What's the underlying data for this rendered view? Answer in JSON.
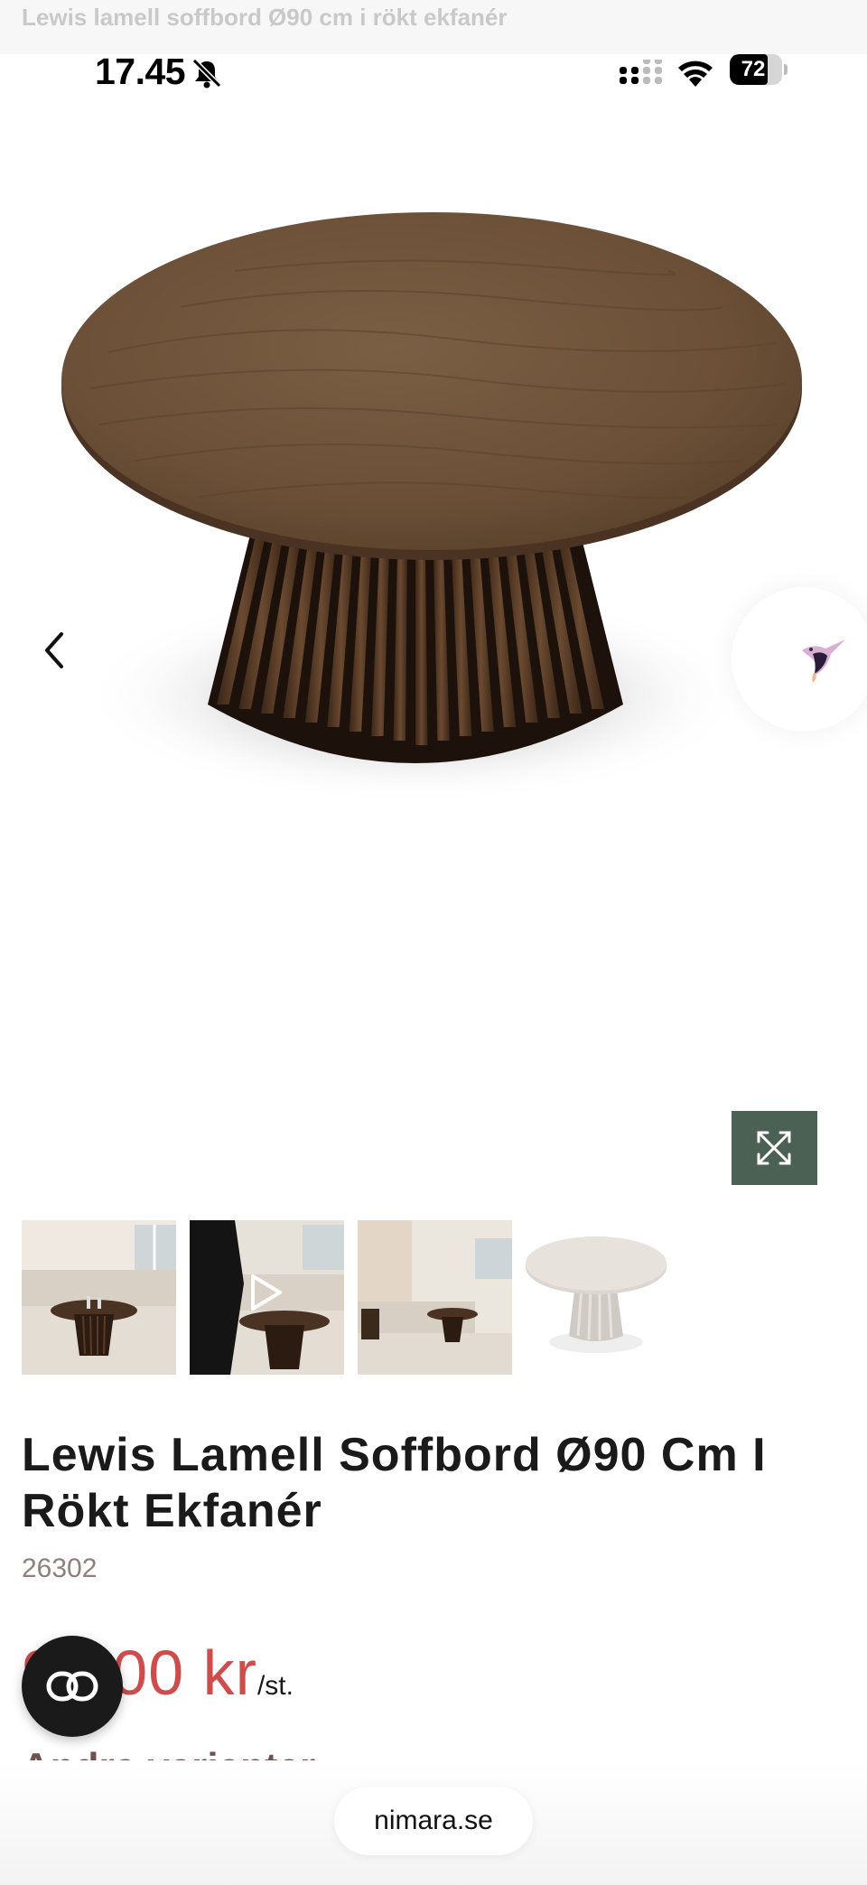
{
  "browser": {
    "page_title": "Lewis lamell soffbord Ø90 cm i rökt ekfanér",
    "url": "nimara.se"
  },
  "status_bar": {
    "time": "17.45",
    "battery_percent": "72",
    "battery_level": 0.72,
    "icons": [
      "bell-slash-icon",
      "cellular-signal-icon",
      "wifi-icon",
      "battery-icon"
    ]
  },
  "gallery": {
    "main_image": "round-dark-oak-slatted-coffee-table",
    "thumbnails": [
      {
        "name": "living-room-photo"
      },
      {
        "name": "video-living-room",
        "has_play_icon": true
      },
      {
        "name": "living-room-wide-photo"
      },
      {
        "name": "white-table-variant"
      }
    ],
    "controls": [
      "chevron-left-icon",
      "expand-arrows-icon"
    ]
  },
  "product": {
    "title": "Lewis Lamell Soffbord Ø90 Cm I Rökt Ekfanér",
    "sku": "26302",
    "price": "99,00 kr",
    "price_unit": "/st.",
    "other_variants_heading": "Andra varianter"
  },
  "colors": {
    "price_red": "#d24b4b",
    "expand_button_green": "#4b6153",
    "heading_brown": "#6e5151",
    "sku_gray": "#8f7f7f"
  }
}
